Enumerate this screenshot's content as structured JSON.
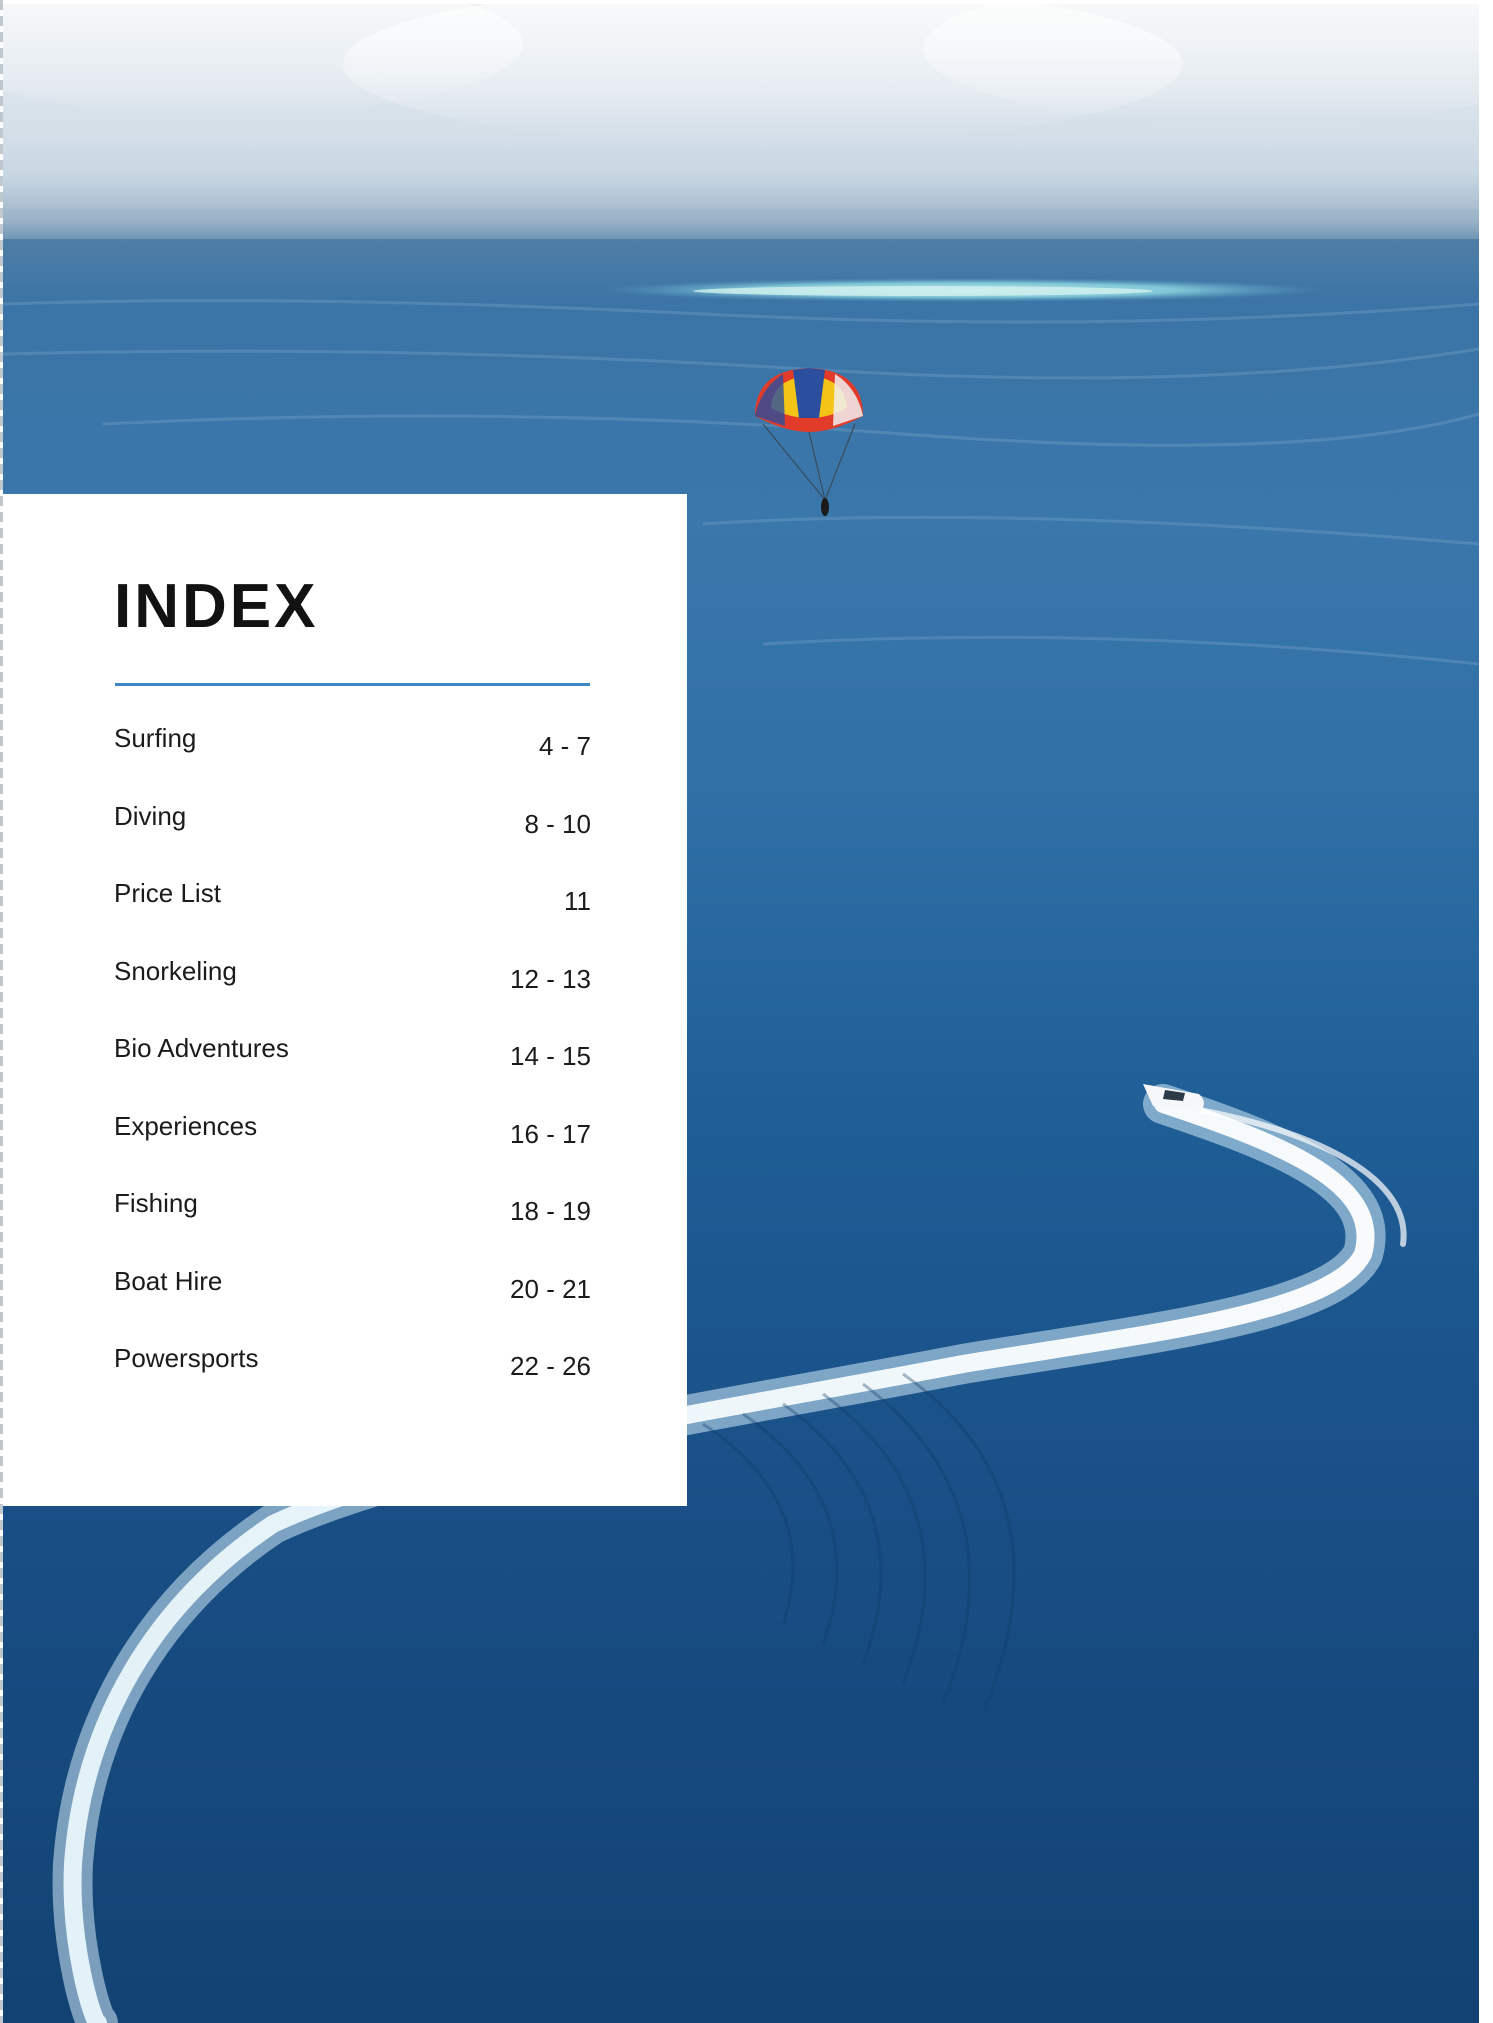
{
  "index": {
    "title": "INDEX",
    "entries": [
      {
        "label": "Surfing",
        "pages": "4 - 7"
      },
      {
        "label": "Diving",
        "pages": "8 - 10"
      },
      {
        "label": "Price List",
        "pages": "11"
      },
      {
        "label": "Snorkeling",
        "pages": "12 - 13"
      },
      {
        "label": "Bio Adventures",
        "pages": "14 - 15"
      },
      {
        "label": "Experiences",
        "pages": "16 - 17"
      },
      {
        "label": "Fishing",
        "pages": "18 - 19"
      },
      {
        "label": "Boat Hire",
        "pages": "20 - 21"
      },
      {
        "label": "Powersports",
        "pages": "22 - 26"
      }
    ]
  },
  "colors": {
    "accent_rule": "#3f86c8",
    "sea": "#1f5e97",
    "sky": "#e9eef2",
    "panel": "#ffffff"
  }
}
